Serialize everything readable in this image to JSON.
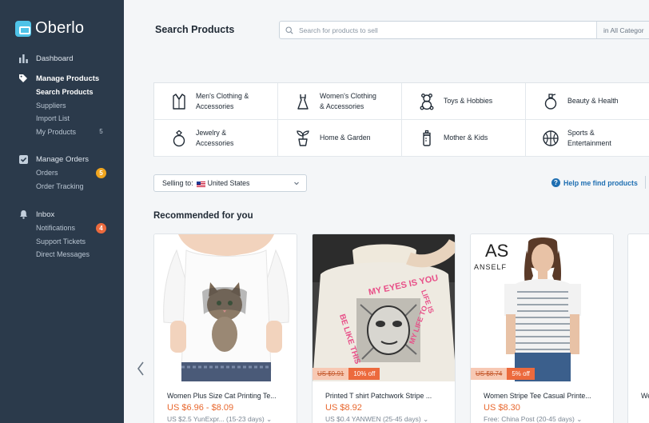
{
  "app": {
    "name": "Oberlo"
  },
  "sidebar": {
    "dashboard": {
      "label": "Dashboard"
    },
    "manage_products": {
      "label": "Manage Products",
      "items": [
        {
          "label": "Search Products",
          "active": true
        },
        {
          "label": "Suppliers"
        },
        {
          "label": "Import List"
        },
        {
          "label": "My Products",
          "count": "5"
        }
      ]
    },
    "manage_orders": {
      "label": "Manage Orders",
      "items": [
        {
          "label": "Orders",
          "badge": "5"
        },
        {
          "label": "Order Tracking"
        }
      ]
    },
    "inbox": {
      "label": "Inbox",
      "items": [
        {
          "label": "Notifications",
          "badge": "4"
        },
        {
          "label": "Support Tickets"
        },
        {
          "label": "Direct Messages"
        }
      ]
    }
  },
  "header": {
    "title": "Search Products",
    "search_placeholder": "Search for products to sell",
    "category_select": "in All Categor"
  },
  "categories": [
    {
      "label": "Men's Clothing &\nAccessories",
      "icon": "shirt-icon"
    },
    {
      "label": "Women's Clothing\n& Accessories",
      "icon": "dress-icon"
    },
    {
      "label": "Toys & Hobbies",
      "icon": "teddy-bear-icon"
    },
    {
      "label": "Beauty & Health",
      "icon": "perfume-icon"
    },
    {
      "label": "Jewelry &\nAccessories",
      "icon": "ring-icon"
    },
    {
      "label": "Home & Garden",
      "icon": "plant-icon"
    },
    {
      "label": "Mother & Kids",
      "icon": "baby-bottle-icon"
    },
    {
      "label": "Sports &\nEntertainment",
      "icon": "ball-icon"
    }
  ],
  "selling": {
    "label": "Selling to:",
    "country": "United States"
  },
  "help": {
    "label": "Help me find products"
  },
  "recommended": {
    "title": "Recommended for you",
    "products": [
      {
        "title": "Women Plus Size Cat Printing Te...",
        "price": "US $6.96 - $8.09",
        "shipping": "US $2.5 YunExpr...  (15-23 days)"
      },
      {
        "title": "Printed T shirt Patchwork Stripe ...",
        "price": "US $8.92",
        "old_price": "US $9.91",
        "discount": "10% off",
        "shipping": "US $0.4 YANWEN  (25-45 days)",
        "image_text": "MY EYES IS YOU",
        "image_text_2": "BE LIKE THIS",
        "image_text_3": "LIFE IS",
        "image_text_4": "MY LIFE TO"
      },
      {
        "title": "Women Stripe Tee Casual Printe...",
        "price": "US $8.30",
        "old_price": "US $8.74",
        "discount": "5% off",
        "shipping": "Free: China Post    (20-45 days)",
        "brand_mark": "AS",
        "brand": "ANSELF"
      }
    ],
    "partial_title": "We"
  },
  "colors": {
    "sidebar": "#2b3a4b",
    "accent": "#4fc3e8",
    "price": "#e8682f",
    "link": "#1f6fb2"
  }
}
